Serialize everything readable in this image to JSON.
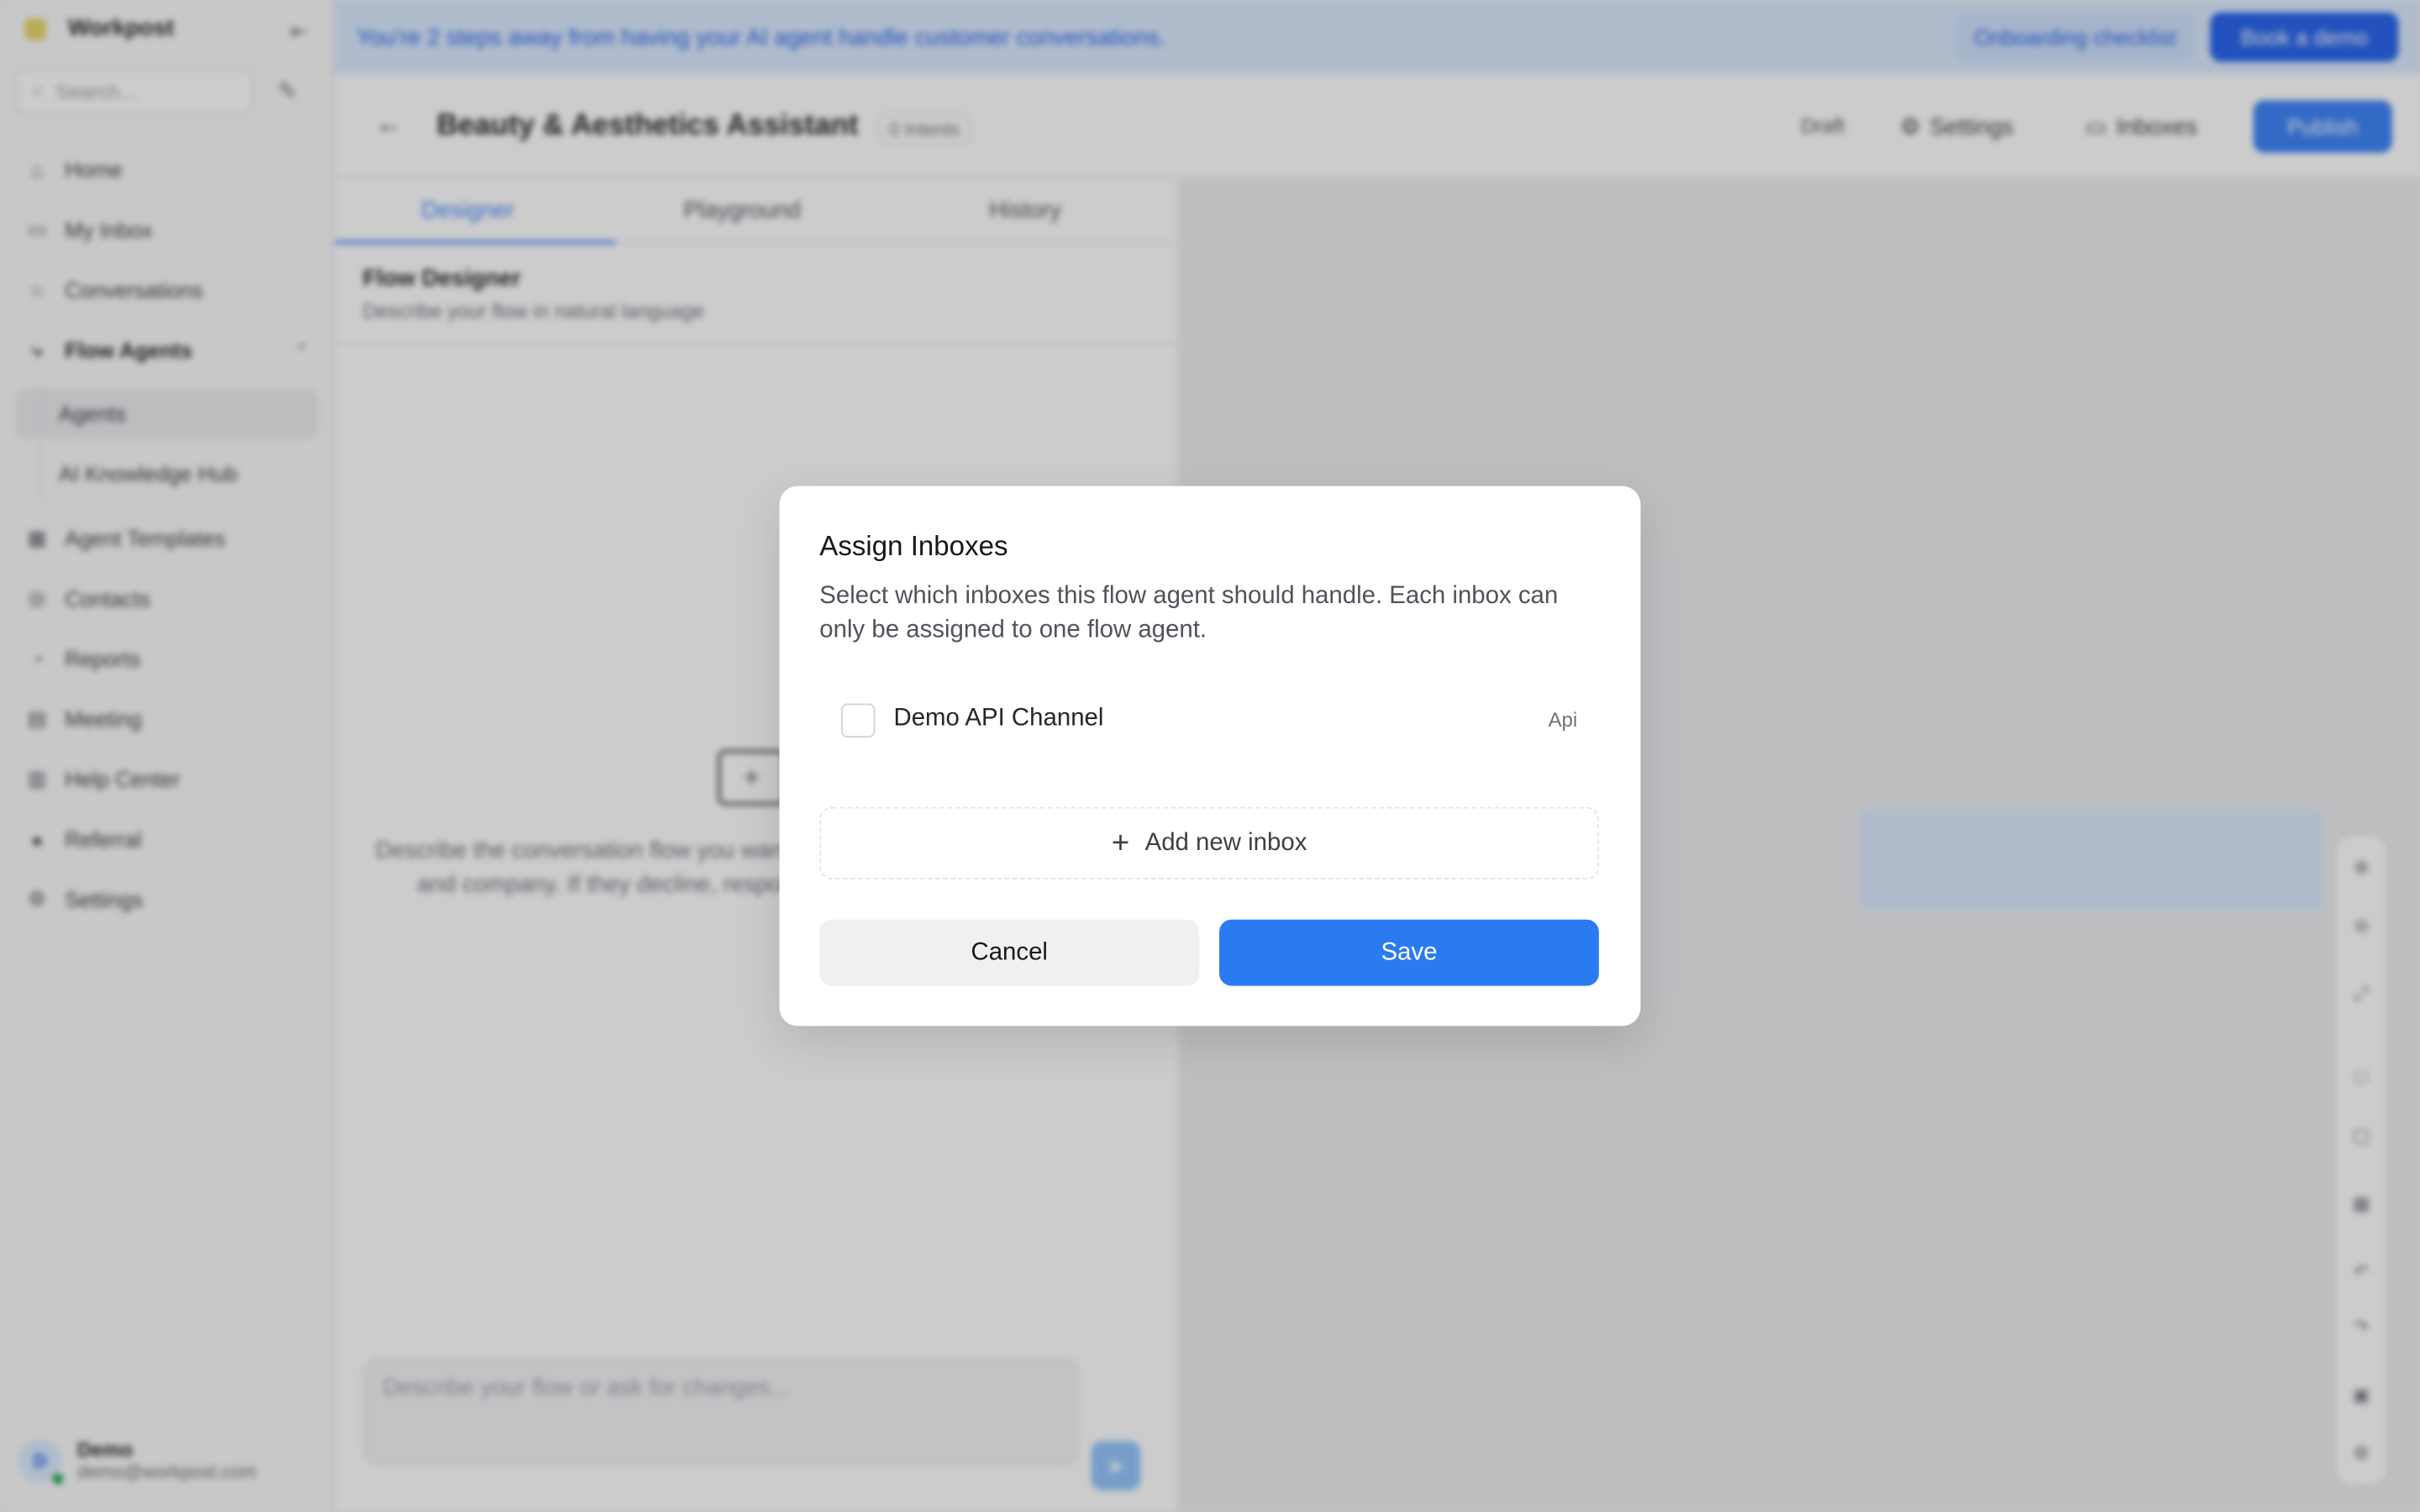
{
  "sidebar": {
    "brand": "Workpost",
    "search_placeholder": "Search...",
    "items": [
      {
        "label": "Home",
        "icon": "home-icon"
      },
      {
        "label": "My Inbox",
        "icon": "inbox-icon"
      },
      {
        "label": "Conversations",
        "icon": "chat-icon"
      },
      {
        "label": "Flow Agents",
        "icon": "flow-icon"
      },
      {
        "label": "Agents"
      },
      {
        "label": "AI Knowledge Hub"
      },
      {
        "label": "Agent Templates",
        "icon": "template-icon"
      },
      {
        "label": "Contacts",
        "icon": "contacts-icon"
      },
      {
        "label": "Reports",
        "icon": "reports-icon"
      },
      {
        "label": "Meeting",
        "icon": "meeting-icon"
      },
      {
        "label": "Help Center",
        "icon": "book-icon"
      },
      {
        "label": "Referral",
        "icon": "gift-icon"
      },
      {
        "label": "Settings",
        "icon": "gear-icon"
      }
    ],
    "user": {
      "initial": "D",
      "name": "Demo",
      "email": "demo@workpost.com"
    }
  },
  "banner": {
    "text": "You're 2 steps away from having your AI agent handle customer conversations.",
    "checklist": "Onboarding checklist",
    "cta": "Book a demo"
  },
  "header": {
    "title": "Beauty & Aesthetics Assistant",
    "badge": "0 Intents",
    "status": "Draft",
    "settings": "Settings",
    "inboxes": "Inboxes",
    "publish": "Publish"
  },
  "panel": {
    "tabs": [
      "Designer",
      "Playground",
      "History"
    ],
    "title": "Flow Designer",
    "subtitle": "Describe your flow in natural language",
    "empty_text": "Describe the conversation flow you want to build. e.g. Ask for name, email, and company. If they decline, respond politely. Otherwise hand off.",
    "input_placeholder": "Describe your flow or ask for changes..."
  },
  "modal": {
    "title": "Assign Inboxes",
    "description": "Select which inboxes this flow agent should handle. Each inbox can only be assigned to one flow agent.",
    "inbox": {
      "name": "Demo API Channel",
      "type": "Api",
      "checked": false
    },
    "add_label": "Add new inbox",
    "cancel_label": "Cancel",
    "save_label": "Save"
  },
  "colors": {
    "accent": "#2b7bf0",
    "banner_bg": "#dbeafe"
  }
}
